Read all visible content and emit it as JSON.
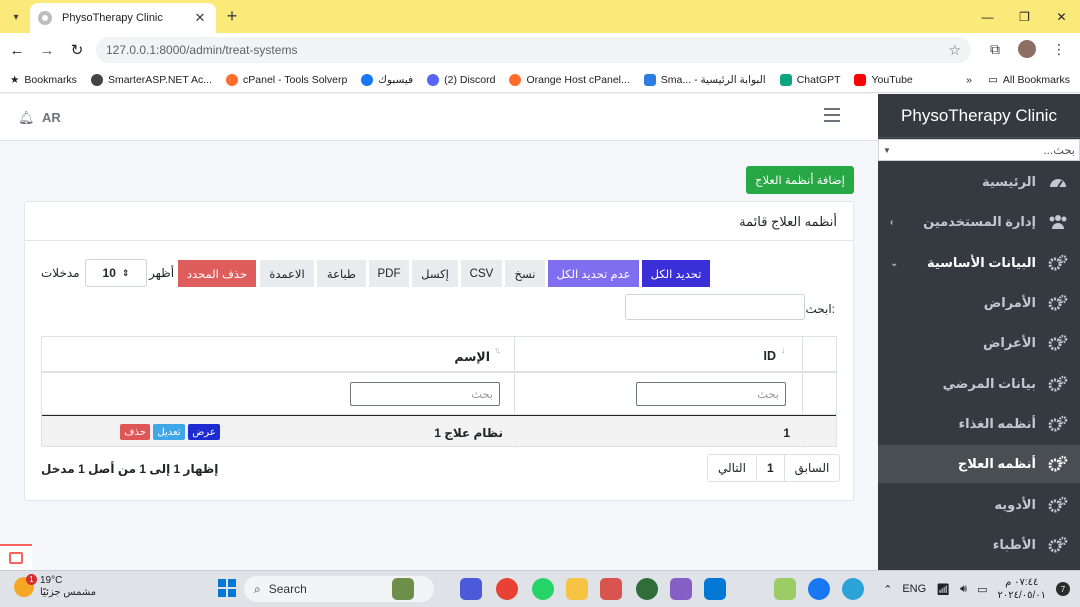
{
  "browser": {
    "tab_title": "PhysoTherapy Clinic",
    "url": "127.0.0.1:8000/admin/treat-systems",
    "bookmarks": [
      {
        "label": "Bookmarks",
        "icon": "star-icon",
        "color": "#202124"
      },
      {
        "label": "SmarterASP.NET Ac...",
        "icon": "smarterasp-icon",
        "color": "#333333"
      },
      {
        "label": "cPanel - Tools Solverp",
        "icon": "cpanel-icon",
        "color": "#ff6c2c"
      },
      {
        "label": "فيسبوك",
        "icon": "facebook-icon",
        "color": "#1877f2"
      },
      {
        "label": "(2) Discord",
        "icon": "discord-icon",
        "color": "#5865f2"
      },
      {
        "label": "Orange Host cPanel...",
        "icon": "orange-host-icon",
        "color": "#ff6c2c"
      },
      {
        "label": "Sma... - البوابة الرئيسية",
        "icon": "portal-icon",
        "color": "#2a7de1"
      },
      {
        "label": "ChatGPT",
        "icon": "chatgpt-icon",
        "color": "#10a37f"
      },
      {
        "label": "YouTube",
        "icon": "youtube-icon",
        "color": "#ff0000"
      }
    ],
    "all_bookmarks": "All Bookmarks"
  },
  "topnav": {
    "lang": "AR"
  },
  "page": {
    "add_button": "إضافة أنظمة العلاج",
    "card_title": "أنظمه العلاج قائمة",
    "buttons": {
      "select_all": "تحديد الكل",
      "deselect_all": "عدم تحديد الكل",
      "copy": "نسخ",
      "csv": "CSV",
      "excel": "إكسل",
      "pdf": "PDF",
      "print": "طباعة",
      "columns": "الاعمدة",
      "delete_selected": "حذف المحدد"
    },
    "length_show": "أظهر",
    "length_value": "10",
    "length_entries": "مدخلات",
    "search_label": "ابحث:",
    "columns": {
      "id": "ID",
      "name": "الإسم"
    },
    "filter_placeholder": "بحث",
    "rows": [
      {
        "id": "1",
        "name": "نظام علاج 1",
        "view": "عرض",
        "edit": "تعديل",
        "delete": "حذف"
      }
    ],
    "pagination": {
      "prev": "السابق",
      "current": "1",
      "next": "التالي"
    },
    "info": "إظهار 1 إلى 1 من أصل 1 مدخل"
  },
  "sidebar": {
    "brand": "PhysoTherapy Clinic",
    "search_placeholder": "بحث...",
    "items": [
      {
        "label": "الرئيسية",
        "icon": "dashboard-icon"
      },
      {
        "label": "إدارة المستخدمين",
        "icon": "users-icon",
        "chevron": "‹"
      },
      {
        "label": "البيانات الأساسية",
        "icon": "gears-icon",
        "chevron": "⌄"
      },
      {
        "label": "الأمراض",
        "icon": "gears-icon"
      },
      {
        "label": "الأعراض",
        "icon": "gears-icon"
      },
      {
        "label": "بيانات المرضي",
        "icon": "gears-icon"
      },
      {
        "label": "أنظمه الغذاء",
        "icon": "gears-icon"
      },
      {
        "label": "أنظمه العلاج",
        "icon": "gears-icon",
        "active": true
      },
      {
        "label": "الأدويه",
        "icon": "gears-icon"
      },
      {
        "label": "الأطباء",
        "icon": "gears-icon"
      }
    ]
  },
  "taskbar": {
    "weather_temp": "19°C",
    "weather_desc": "مشمس جزئيًا",
    "weather_badge": "1",
    "search": "Search",
    "lang": "ENG",
    "time": "٠٧:٤٤ م",
    "date": "٢٠٢٤/٠٥/٠١",
    "notifications": "7"
  },
  "colors": {
    "success": "#28a745",
    "danger": "#e05d5d",
    "select_all": "#3b2fd8",
    "deselect_all": "#7f6ff0",
    "view": "#1d2bd1",
    "edit": "#3fa6e8",
    "delete": "#e05555",
    "sidebar_bg": "#343a40",
    "chrome_yellow": "#fbe97a"
  }
}
